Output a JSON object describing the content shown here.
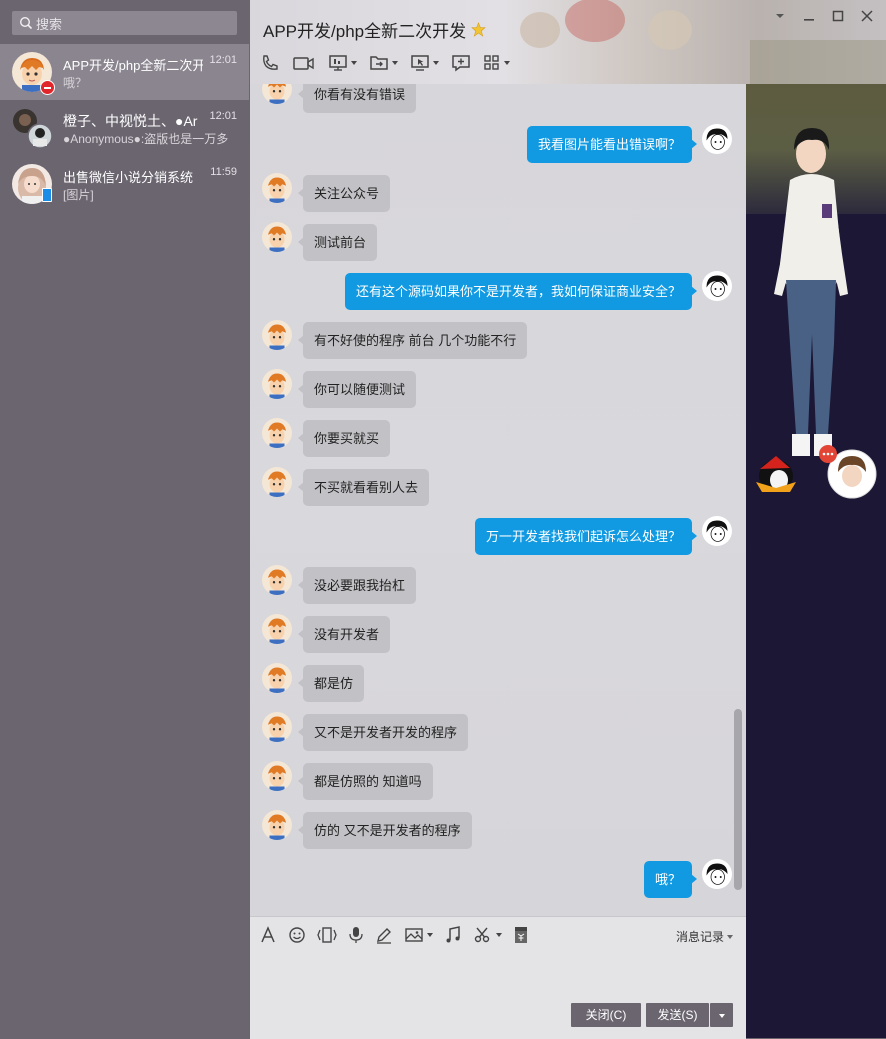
{
  "sidebar": {
    "search_placeholder": "搜索",
    "conversations": [
      {
        "name": "APP开发/php全新二次开发",
        "time": "12:01",
        "preview": "哦？",
        "active": true
      },
      {
        "name": "橙子、中视悦土、●Ar",
        "time": "12:01",
        "preview": "●Anonymous●:盗版也是一万多",
        "active": false
      },
      {
        "name": "出售微信小说分销系统",
        "time": "11:59",
        "preview": "[图片]",
        "active": false
      }
    ]
  },
  "header": {
    "title": "APP开发/php全新二次开发",
    "toolbar_icons": [
      "phone-icon",
      "video-icon",
      "screen-share-icon",
      "file-transfer-icon",
      "remote-desktop-icon",
      "add-app-icon",
      "apps-grid-icon"
    ]
  },
  "messages": [
    {
      "dir": "in",
      "text": "你看有没有错误"
    },
    {
      "dir": "out",
      "text": "我看图片能看出错误啊？"
    },
    {
      "dir": "in",
      "text": "关注公众号"
    },
    {
      "dir": "in",
      "text": "测试前台"
    },
    {
      "dir": "out",
      "text": "还有这个源码如果你不是开发者，我如何保证商业安全？"
    },
    {
      "dir": "in",
      "text": "有不好使的程序 前台 几个功能不行"
    },
    {
      "dir": "in",
      "text": "你可以随便测试"
    },
    {
      "dir": "in",
      "text": "你要买就买"
    },
    {
      "dir": "in",
      "text": "不买就看看别人去"
    },
    {
      "dir": "out",
      "text": "万一开发者找我们起诉怎么处理？"
    },
    {
      "dir": "in",
      "text": "没必要跟我抬杠"
    },
    {
      "dir": "in",
      "text": "没有开发者"
    },
    {
      "dir": "in",
      "text": "都是仿"
    },
    {
      "dir": "in",
      "text": "又不是开发者开发的程序"
    },
    {
      "dir": "in",
      "text": "都是仿照的 知道吗"
    },
    {
      "dir": "in",
      "text": "仿的 又不是开发者的程序"
    },
    {
      "dir": "out",
      "text": "哦？"
    }
  ],
  "input": {
    "history_label": "消息记录",
    "close_label": "关闭(C)",
    "send_label": "发送(S)"
  },
  "colors": {
    "sidebar_bg": "#6b6570",
    "out_bubble": "#119ae2",
    "in_bubble": "#c2c1c6",
    "chat_bg": "#d7d6da"
  }
}
